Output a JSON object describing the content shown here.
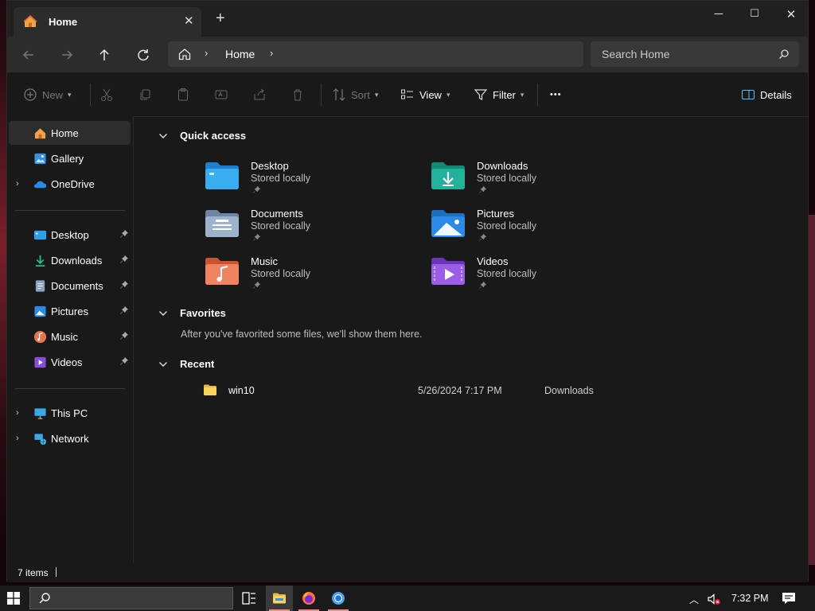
{
  "window": {
    "tab_title": "Home",
    "controls": {
      "minimize": "─",
      "maximize": "☐",
      "close": "✕"
    }
  },
  "nav": {
    "breadcrumb": "Home",
    "search_placeholder": "Search Home"
  },
  "toolbar": {
    "new_label": "New",
    "sort_label": "Sort",
    "view_label": "View",
    "filter_label": "Filter",
    "more_label": "•••",
    "details_label": "Details"
  },
  "sidebar": {
    "top": [
      {
        "label": "Home",
        "icon": "home-icon"
      },
      {
        "label": "Gallery",
        "icon": "gallery-icon"
      },
      {
        "label": "OneDrive",
        "icon": "onedrive-icon"
      }
    ],
    "pinned": [
      {
        "label": "Desktop",
        "icon": "desktop-folder-icon"
      },
      {
        "label": "Downloads",
        "icon": "downloads-icon"
      },
      {
        "label": "Documents",
        "icon": "documents-icon"
      },
      {
        "label": "Pictures",
        "icon": "pictures-icon"
      },
      {
        "label": "Music",
        "icon": "music-icon"
      },
      {
        "label": "Videos",
        "icon": "videos-icon"
      }
    ],
    "bottom": [
      {
        "label": "This PC",
        "icon": "this-pc-icon"
      },
      {
        "label": "Network",
        "icon": "network-icon"
      }
    ]
  },
  "main": {
    "quick_access_title": "Quick access",
    "quick_access": [
      {
        "name": "Desktop",
        "sub": "Stored locally",
        "color": "#2f9ee8"
      },
      {
        "name": "Downloads",
        "sub": "Stored locally",
        "color": "#22b29b"
      },
      {
        "name": "Documents",
        "sub": "Stored locally",
        "color": "#8aa2bf"
      },
      {
        "name": "Pictures",
        "sub": "Stored locally",
        "color": "#2a8ae6"
      },
      {
        "name": "Music",
        "sub": "Stored locally",
        "color": "#e8734f"
      },
      {
        "name": "Videos",
        "sub": "Stored locally",
        "color": "#8a4ed6"
      }
    ],
    "favorites_title": "Favorites",
    "favorites_empty": "After you've favorited some files, we'll show them here.",
    "recent_title": "Recent",
    "recent": [
      {
        "name": "win10",
        "date": "5/26/2024 7:17 PM",
        "location": "Downloads"
      }
    ]
  },
  "status": {
    "item_count": "7 items"
  },
  "taskbar": {
    "time": "7:32 PM"
  },
  "colors": {
    "accent": "#4cc2ff",
    "window_bg": "#191919",
    "toolbar_bg": "#2c2c2c"
  }
}
